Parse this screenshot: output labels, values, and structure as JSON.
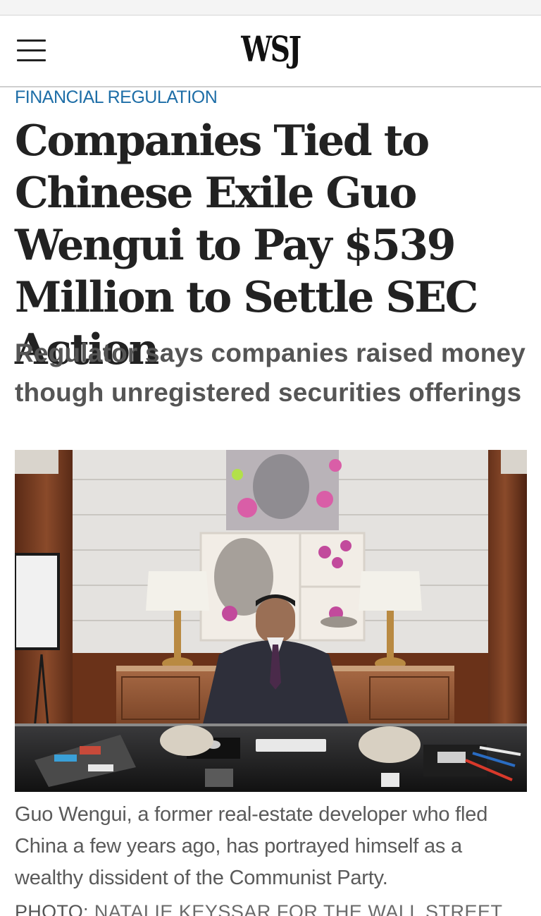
{
  "header": {
    "logo": "WSJ"
  },
  "article": {
    "kicker": "FINANCIAL REGULATION",
    "headline": "Companies Tied to Chinese Exile Guo Wengui to Pay $539 Million to Settle SEC Action",
    "dek": "Regulator says companies raised money though unregistered securities offerings",
    "caption": "Guo Wengui, a former real-estate developer who fled China a few years ago, has portrayed himself as a wealthy dissident of the Communist Party.",
    "credit_label": "PHOTO:",
    "credit_text": " NATALIE KEYSSAR FOR THE WALL STREET"
  },
  "icons": {
    "menu": "hamburger-menu-icon"
  }
}
